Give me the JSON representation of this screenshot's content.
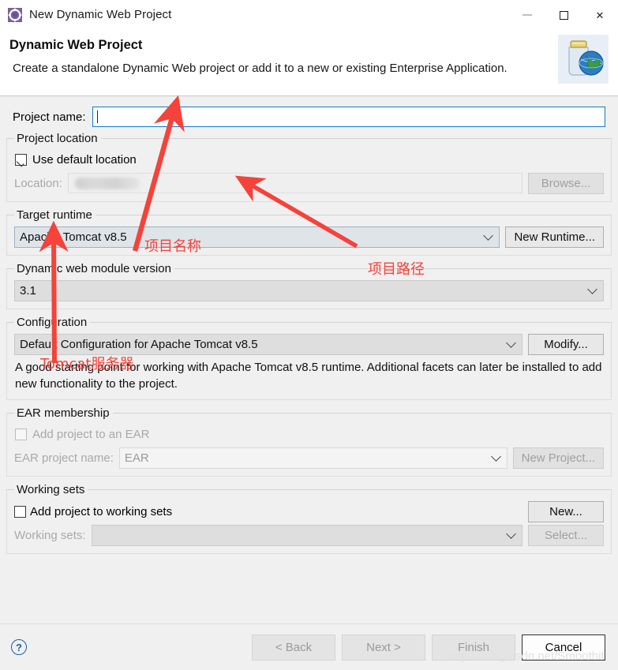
{
  "window": {
    "title": "New Dynamic Web Project",
    "icon": "eclipse-project-icon",
    "minimize_label": "minimize-icon",
    "maximize_label": "maximize-icon",
    "close_label": "close-icon"
  },
  "banner": {
    "heading": "Dynamic Web Project",
    "subtitle": "Create a standalone Dynamic Web project or add it to a new or existing Enterprise Application.",
    "icon": "web-project-jar-globe-icon"
  },
  "project_name": {
    "label": "Project name:",
    "value": "",
    "placeholder": ""
  },
  "project_location": {
    "legend": "Project location",
    "use_default_label": "Use default location",
    "use_default_checked": true,
    "location_label": "Location:",
    "location_value": "",
    "location_redacted": true,
    "browse_label": "Browse...",
    "browse_enabled": false
  },
  "target_runtime": {
    "legend": "Target runtime",
    "value": "Apache Tomcat v8.5",
    "new_runtime_label": "New Runtime...",
    "new_runtime_enabled": true
  },
  "module_version": {
    "legend": "Dynamic web module version",
    "value": "3.1"
  },
  "configuration": {
    "legend": "Configuration",
    "value": "Default Configuration for Apache Tomcat v8.5",
    "modify_label": "Modify...",
    "modify_enabled": true,
    "description": "A good starting point for working with Apache Tomcat v8.5 runtime. Additional facets can later be installed to add new functionality to the project."
  },
  "ear_membership": {
    "legend": "EAR membership",
    "add_to_ear_label": "Add project to an EAR",
    "add_to_ear_checked": false,
    "ear_project_label": "EAR project name:",
    "ear_project_value": "EAR",
    "new_project_label": "New Project...",
    "new_project_enabled": false
  },
  "working_sets": {
    "legend": "Working sets",
    "add_to_working_sets_label": "Add project to working sets",
    "add_to_working_sets_checked": false,
    "working_sets_label": "Working sets:",
    "working_sets_value": "",
    "new_label": "New...",
    "new_enabled": true,
    "select_label": "Select...",
    "select_enabled": false
  },
  "footer": {
    "help_label": "?",
    "back_label": "< Back",
    "back_enabled": false,
    "next_label": "Next >",
    "next_enabled": false,
    "finish_label": "Finish",
    "finish_enabled": false,
    "cancel_label": "Cancel",
    "cancel_enabled": true
  },
  "annotations": {
    "accent_color": "#f4433a",
    "labels": [
      {
        "text": "项目名称",
        "meaning": "project-name"
      },
      {
        "text": "项目路径",
        "meaning": "project-path"
      },
      {
        "text": "Tomcat服务器",
        "meaning": "tomcat-server"
      }
    ],
    "arrows": 3
  },
  "watermark": {
    "text": "https://blog.csdn.net/Smoothit"
  }
}
